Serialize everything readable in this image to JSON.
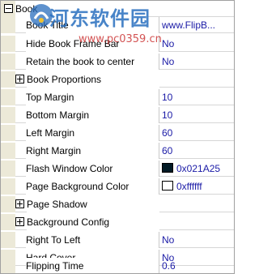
{
  "root": {
    "label": "Book"
  },
  "book_rows": [
    {
      "name": "Book Title",
      "value": "www.FlipB..."
    },
    {
      "name": "Hide Book Frame Bar",
      "value": "No"
    },
    {
      "name": "Retain the book to center",
      "value": "No"
    }
  ],
  "group_book_proportions": {
    "label": "Book Proportions"
  },
  "margin_rows": [
    {
      "name": "Top Margin",
      "value": "10"
    },
    {
      "name": "Bottom Margin",
      "value": "10"
    },
    {
      "name": "Left Margin",
      "value": "60"
    },
    {
      "name": "Right Margin",
      "value": "60"
    }
  ],
  "color_rows": [
    {
      "name": "Flash Window Color",
      "value": "0x021A25",
      "swatch": "#021A25"
    },
    {
      "name": "Page Background Color",
      "value": "0xffffff",
      "swatch": "#ffffff"
    }
  ],
  "group_page_shadow": {
    "label": "Page Shadow"
  },
  "group_background_config": {
    "label": "Background Config"
  },
  "end_rows": [
    {
      "name": "Right To Left",
      "value": "No"
    },
    {
      "name": "Hard Cover",
      "value": "No"
    },
    {
      "name": "Flipping Time",
      "value": "0.6"
    }
  ],
  "watermark": {
    "title": "河东软件园",
    "url": "www.pc0359.cn"
  },
  "colors": {
    "value_text": "#1a1aa6",
    "gutter": "#ece9d8",
    "grid_line": "#d6d6d6"
  }
}
